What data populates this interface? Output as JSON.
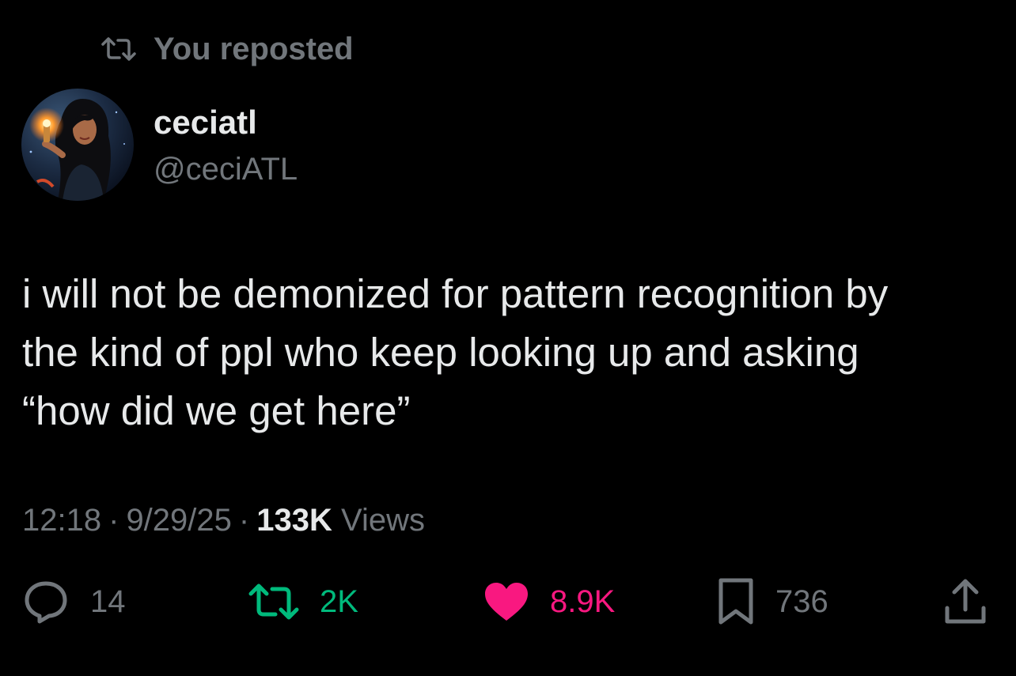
{
  "repost_banner": {
    "icon": "repost-icon",
    "label": "You reposted"
  },
  "author": {
    "avatar": "avatar",
    "display_name": "ceciatl",
    "handle": "@ceciATL"
  },
  "tweet": {
    "text": "i will not be demonized for pattern recognition by\nthe kind of ppl who keep looking up and asking\n“how did we get here”"
  },
  "meta": {
    "time": "12:18",
    "separator": "·",
    "date": "9/29/25",
    "views_count": "133K",
    "views_label": "Views"
  },
  "actions": {
    "reply": {
      "icon": "reply-icon",
      "count": "14"
    },
    "retweet": {
      "icon": "repost-icon",
      "count": "2K",
      "color": "#00ba7c"
    },
    "like": {
      "icon": "heart-icon",
      "count": "8.9K",
      "color": "#f91880"
    },
    "bookmark": {
      "icon": "bookmark-icon",
      "count": "736"
    },
    "share": {
      "icon": "share-icon"
    }
  },
  "colors": {
    "background": "#000000",
    "primary_text": "#e7e9ea",
    "secondary_text": "#71767b"
  }
}
